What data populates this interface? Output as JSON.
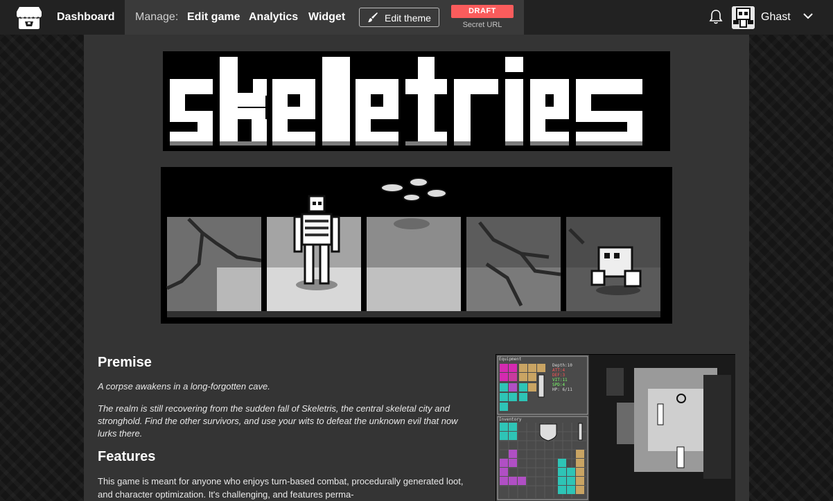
{
  "topbar": {
    "dashboard_label": "Dashboard",
    "manage_label": "Manage:",
    "links": [
      "Edit game",
      "Analytics",
      "Widget"
    ],
    "edit_theme_label": "Edit theme",
    "draft_badge": "DRAFT",
    "secret_url_label": "Secret URL",
    "username": "Ghast",
    "icons": [
      "itchio-logo-icon",
      "brush-icon",
      "bell-icon",
      "chevron-down-icon"
    ]
  },
  "game": {
    "title": "skeletris"
  },
  "premise": {
    "heading": "Premise",
    "subtitle": "A corpse awakens in a long-forgotten cave.",
    "text": "The realm is still recovering from the sudden fall of Skeletris, the central skeletal city and stronghold. Find the other survivors, and use your wits to defeat the unknown evil that now lurks there."
  },
  "features": {
    "heading": "Features",
    "text": "This game is meant for anyone who enjoys turn-based combat, procedurally generated loot, and character optimization. It's challenging, and features perma-"
  },
  "screenshot": {
    "equipment_label": "Equipment",
    "inventory_label": "Inventory",
    "stats": [
      "Depth:10",
      "ATT:4",
      "DEF:3",
      "VIT:11",
      "SPD:4",
      "HP: 6/11"
    ]
  },
  "colors": {
    "accent": "#fa5c5c",
    "topbar_bg": "#222222",
    "manage_bg": "#3a3a3a",
    "page_bg": "#343434"
  }
}
